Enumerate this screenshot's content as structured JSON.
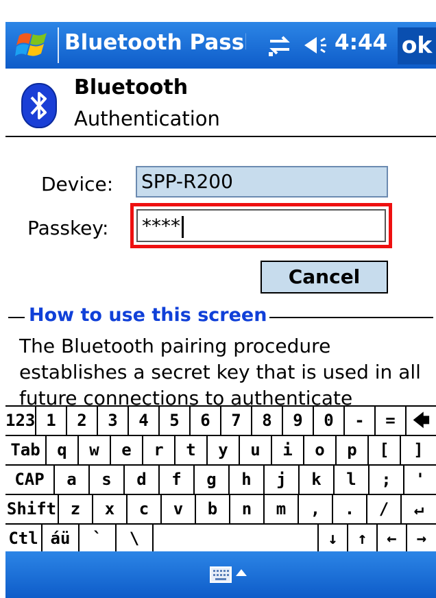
{
  "titlebar": {
    "title": "Bluetooth Passl",
    "time": "4:44",
    "ok_label": "ok"
  },
  "header": {
    "title": "Bluetooth",
    "subtitle": "Authentication"
  },
  "form": {
    "device_label": "Device:",
    "device_value": "SPP-R200",
    "passkey_label": "Passkey:",
    "passkey_value": "****",
    "cancel_label": "Cancel"
  },
  "howto": {
    "title": "How to use this screen",
    "text": "The Bluetooth pairing procedure establishes a secret key that is used in all future connections to authenticate"
  },
  "keyboard": {
    "rows": [
      [
        "123",
        "1",
        "2",
        "3",
        "4",
        "5",
        "6",
        "7",
        "8",
        "9",
        "0",
        "-",
        "=",
        "🡄"
      ],
      [
        "Tab",
        "q",
        "w",
        "e",
        "r",
        "t",
        "y",
        "u",
        "i",
        "o",
        "p",
        "[",
        "]"
      ],
      [
        "CAP",
        "a",
        "s",
        "d",
        "f",
        "g",
        "h",
        "j",
        "k",
        "l",
        ";",
        "'"
      ],
      [
        "Shift",
        "z",
        "x",
        "c",
        "v",
        "b",
        "n",
        "m",
        ",",
        ".",
        "/",
        "↵"
      ],
      [
        "Ctl",
        "áü",
        "`",
        "\\",
        "",
        "↓",
        "↑",
        "←",
        "→"
      ]
    ]
  },
  "colors": {
    "accent": "#1a6fd8",
    "field_bg": "#c7dced",
    "highlight_border": "#ee1010",
    "howto_title": "#1040d8"
  },
  "icons": [
    "windows-start-icon",
    "connectivity-icon",
    "volume-icon",
    "bluetooth-icon",
    "keyboard-icon",
    "input-panel-arrow-icon"
  ]
}
